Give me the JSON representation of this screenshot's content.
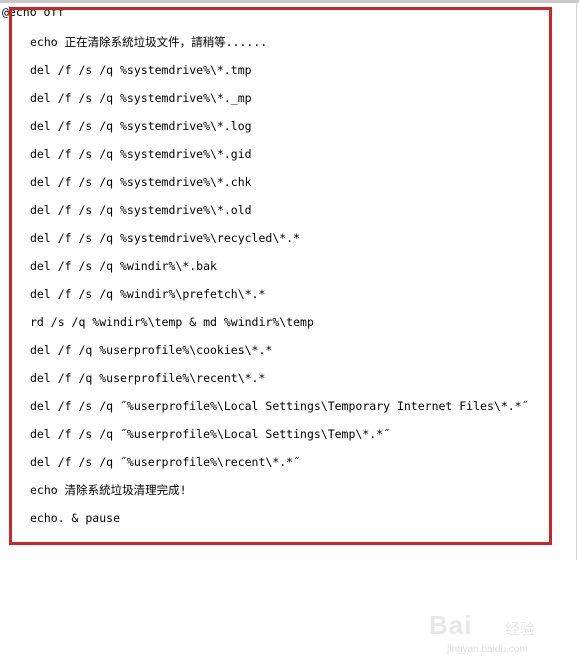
{
  "document": {
    "first_line": "@echo off",
    "lines": [
      "echo 正在清除系統垃圾文件，請稍等......",
      "del /f /s /q %systemdrive%\\*.tmp",
      "del /f /s /q %systemdrive%\\*._mp",
      "del /f /s /q %systemdrive%\\*.log",
      "del /f /s /q %systemdrive%\\*.gid",
      "del /f /s /q %systemdrive%\\*.chk",
      "del /f /s /q %systemdrive%\\*.old",
      "del /f /s /q %systemdrive%\\recycled\\*.*",
      "del /f /s /q %windir%\\*.bak",
      "del /f /s /q %windir%\\prefetch\\*.*",
      "rd /s /q %windir%\\temp & md %windir%\\temp",
      "del /f /q %userprofile%\\cookies\\*.*",
      "del /f /q %userprofile%\\recent\\*.*",
      "del /f /s /q ˝%userprofile%\\Local Settings\\Temporary Internet Files\\*.*˝",
      "del /f /s /q ˝%userprofile%\\Local Settings\\Temp\\*.*˝",
      "del /f /s /q ˝%userprofile%\\recent\\*.*˝",
      "echo 清除系統垃圾清理完成!",
      "echo. & pause"
    ]
  },
  "highlight": {
    "color": "#c9262c"
  },
  "watermark": {
    "brand": "Bai",
    "cn": "经验",
    "url": "jingyan.baidu.com"
  }
}
